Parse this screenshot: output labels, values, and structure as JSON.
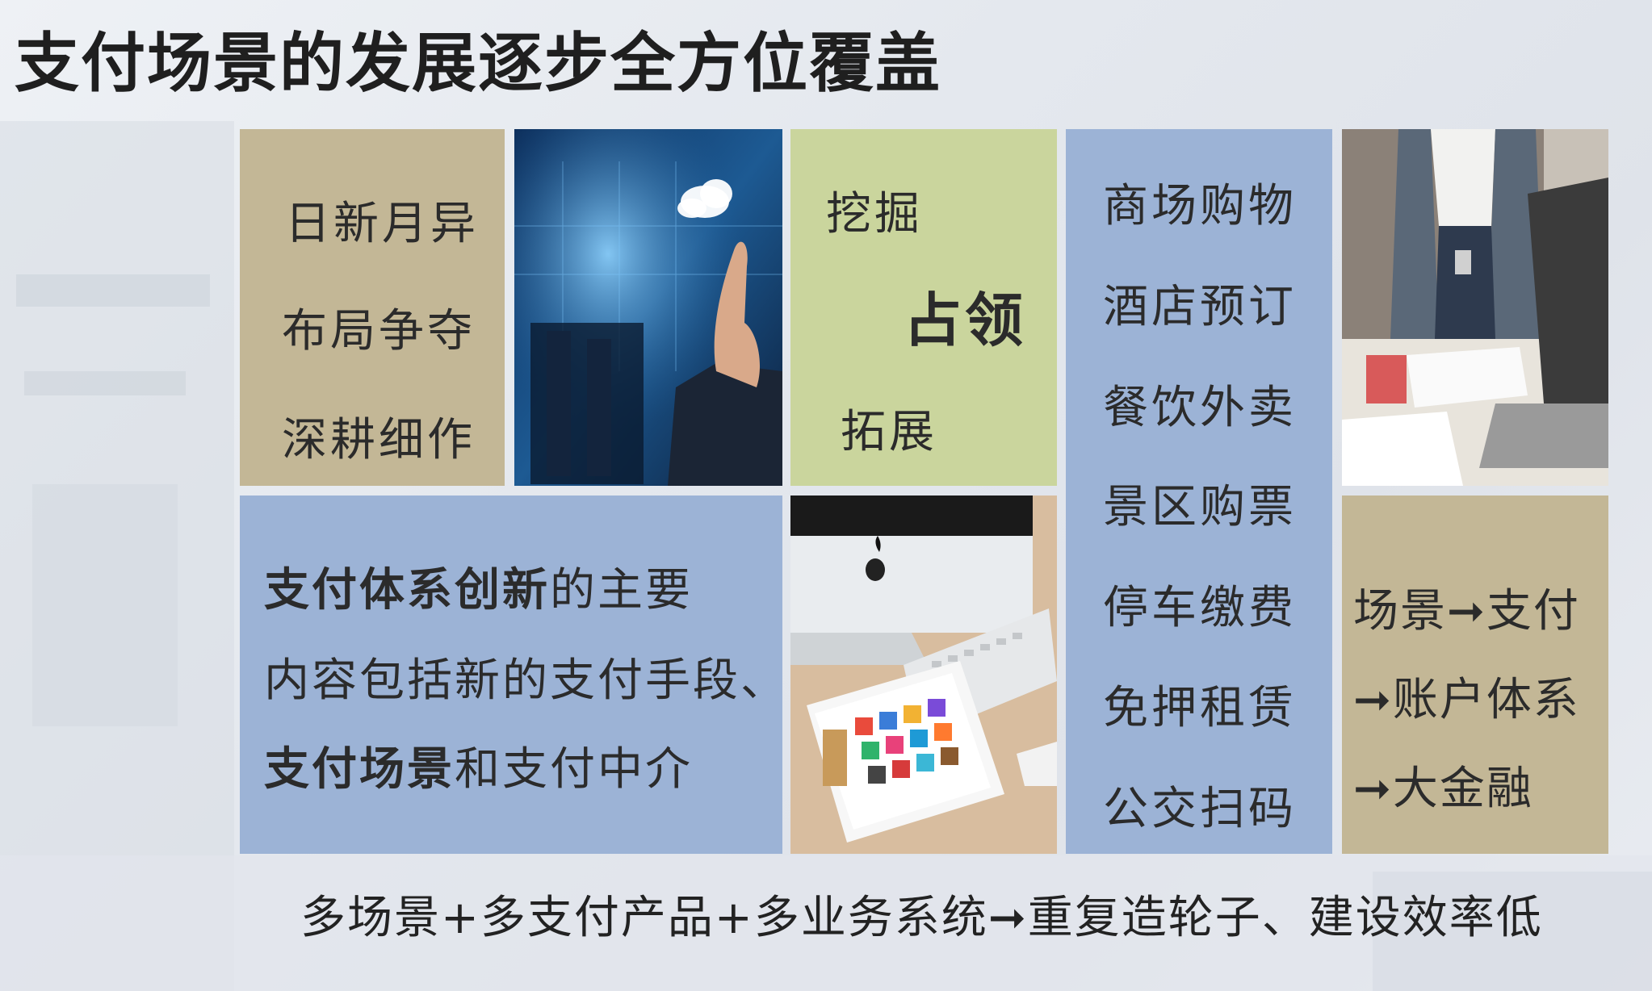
{
  "title": "支付场景的发展逐步全方位覆盖",
  "tile_strategy": {
    "lines": [
      "日新月异",
      "布局争夺",
      "深耕细作"
    ]
  },
  "tile_verbs": {
    "dig": "挖掘",
    "occupy": "占领",
    "expand": "拓展"
  },
  "scenarios": {
    "items": [
      "商场购物",
      "酒店预订",
      "餐饮外卖",
      "景区购票",
      "停车缴费",
      "免押租赁",
      "公交扫码"
    ]
  },
  "innovation": {
    "line1_bold": "支付体系创新",
    "line1_rest": "的主要",
    "line2": "内容包括新的支付手段、",
    "line3_bold": "支付场景",
    "line3_rest": "和支付中介"
  },
  "evolution": {
    "lines": [
      "场景➞支付",
      "➞账户体系",
      "➞大金融"
    ]
  },
  "footer": "多场景+多支付产品+多业务系统➞重复造轮子、建设效率低",
  "colors": {
    "tan": "#c3b796",
    "green": "#cad59d",
    "blue": "#9cb3d6"
  },
  "images": {
    "tech_hand": "businessman-touching-cloud-icon",
    "laptop_desk": "businessman-standing-by-laptop",
    "tablet_desk": "imac-keyboard-and-tablet-apps"
  }
}
